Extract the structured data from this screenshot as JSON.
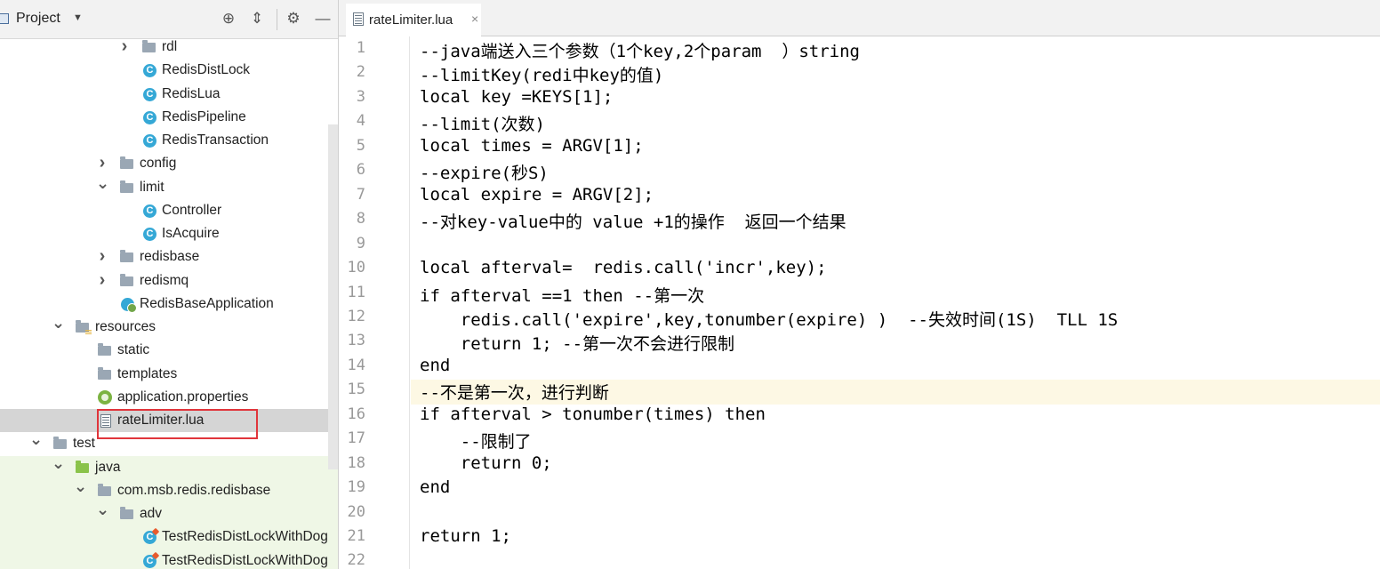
{
  "project_panel": {
    "title": "Project",
    "tree": [
      {
        "label": "rdl",
        "icon": "folder-icon",
        "arrow": "collapsed"
      },
      {
        "label": "RedisDistLock",
        "icon": "class-icon"
      },
      {
        "label": "RedisLua",
        "icon": "class-icon"
      },
      {
        "label": "RedisPipeline",
        "icon": "class-icon"
      },
      {
        "label": "RedisTransaction",
        "icon": "class-icon"
      },
      {
        "label": "config",
        "icon": "folder-icon",
        "arrow": "collapsed"
      },
      {
        "label": "limit",
        "icon": "folder-icon",
        "arrow": "expanded"
      },
      {
        "label": "Controller",
        "icon": "class-icon"
      },
      {
        "label": "IsAcquire",
        "icon": "class-icon"
      },
      {
        "label": "redisbase",
        "icon": "folder-icon",
        "arrow": "collapsed"
      },
      {
        "label": "redismq",
        "icon": "folder-icon",
        "arrow": "collapsed"
      },
      {
        "label": "RedisBaseApplication",
        "icon": "spring-boot-app-icon"
      },
      {
        "label": "resources",
        "icon": "resources-folder-icon",
        "arrow": "expanded"
      },
      {
        "label": "static",
        "icon": "folder-icon"
      },
      {
        "label": "templates",
        "icon": "folder-icon"
      },
      {
        "label": "application.properties",
        "icon": "spring-properties-icon"
      },
      {
        "label": "rateLimiter.lua",
        "icon": "text-file-icon",
        "selected": true
      },
      {
        "label": "test",
        "icon": "folder-icon",
        "arrow": "expanded"
      },
      {
        "label": "java",
        "icon": "test-sources-folder-icon",
        "arrow": "expanded"
      },
      {
        "label": "com.msb.redis.redisbase",
        "icon": "package-icon",
        "arrow": "expanded"
      },
      {
        "label": "adv",
        "icon": "package-icon",
        "arrow": "expanded"
      },
      {
        "label": "TestRedisDistLockWithDog",
        "icon": "test-class-icon"
      },
      {
        "label": "TestRedisDistLockWithDog",
        "icon": "test-class-icon"
      }
    ]
  },
  "editor": {
    "tab_label": "rateLimiter.lua",
    "current_line": 15,
    "lines": [
      {
        "n": "1",
        "text": "--java端送入三个参数（1个key,2个param  ）string"
      },
      {
        "n": "2",
        "text": "--limitKey(redi中key的值)"
      },
      {
        "n": "3",
        "text": "local key =KEYS[1];"
      },
      {
        "n": "4",
        "text": "--limit(次数)"
      },
      {
        "n": "5",
        "text": "local times = ARGV[1];"
      },
      {
        "n": "6",
        "text": "--expire(秒S)"
      },
      {
        "n": "7",
        "text": "local expire = ARGV[2];"
      },
      {
        "n": "8",
        "text": "--对key-value中的 value +1的操作  返回一个结果"
      },
      {
        "n": "9",
        "text": ""
      },
      {
        "n": "10",
        "text": "local afterval=  redis.call('incr',key);"
      },
      {
        "n": "11",
        "text": "if afterval ==1 then --第一次"
      },
      {
        "n": "12",
        "text": "    redis.call('expire',key,tonumber(expire) )  --失效时间(1S)  TLL 1S"
      },
      {
        "n": "13",
        "text": "    return 1; --第一次不会进行限制"
      },
      {
        "n": "14",
        "text": "end"
      },
      {
        "n": "15",
        "text": "--不是第一次，进行判断"
      },
      {
        "n": "16",
        "text": "if afterval > tonumber(times) then"
      },
      {
        "n": "17",
        "text": "    --限制了"
      },
      {
        "n": "18",
        "text": "    return 0;"
      },
      {
        "n": "19",
        "text": "end"
      },
      {
        "n": "20",
        "text": ""
      },
      {
        "n": "21",
        "text": "return 1;"
      },
      {
        "n": "22",
        "text": ""
      }
    ]
  }
}
